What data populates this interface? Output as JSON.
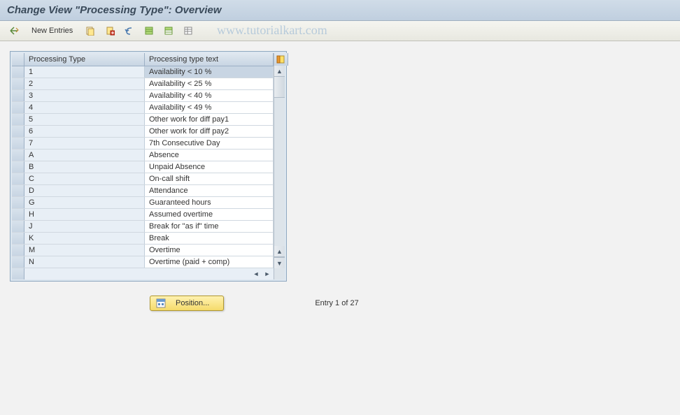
{
  "title": "Change View \"Processing Type\": Overview",
  "watermark": "www.tutorialkart.com",
  "toolbar": {
    "new_entries_label": "New Entries"
  },
  "table": {
    "headers": {
      "type": "Processing Type",
      "text": "Processing type text"
    },
    "rows": [
      {
        "type": "1",
        "text": "Availability < 10 %",
        "selected": true
      },
      {
        "type": "2",
        "text": "Availability < 25 %",
        "selected": false
      },
      {
        "type": "3",
        "text": "Availability < 40 %",
        "selected": false
      },
      {
        "type": "4",
        "text": "Availability < 49 %",
        "selected": false
      },
      {
        "type": "5",
        "text": "Other work for diff pay1",
        "selected": false
      },
      {
        "type": "6",
        "text": "Other work for diff pay2",
        "selected": false
      },
      {
        "type": "7",
        "text": "7th Consecutive Day",
        "selected": false
      },
      {
        "type": "A",
        "text": "Absence",
        "selected": false
      },
      {
        "type": "B",
        "text": "Unpaid Absence",
        "selected": false
      },
      {
        "type": "C",
        "text": "On-call shift",
        "selected": false
      },
      {
        "type": "D",
        "text": "Attendance",
        "selected": false
      },
      {
        "type": "G",
        "text": "Guaranteed hours",
        "selected": false
      },
      {
        "type": "H",
        "text": "Assumed overtime",
        "selected": false
      },
      {
        "type": "J",
        "text": "Break for \"as if\" time",
        "selected": false
      },
      {
        "type": "K",
        "text": "Break",
        "selected": false
      },
      {
        "type": "M",
        "text": "Overtime",
        "selected": false
      },
      {
        "type": "N",
        "text": "Overtime (paid + comp)",
        "selected": false
      }
    ]
  },
  "footer": {
    "position_label": "Position...",
    "entry_status": "Entry 1 of 27"
  }
}
